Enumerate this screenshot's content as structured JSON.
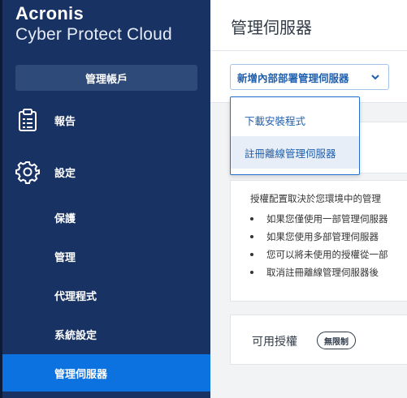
{
  "brand": {
    "name": "Acronis",
    "product": "Cyber Protect Cloud"
  },
  "sidebar": {
    "manage_account": "管理帳戶",
    "main_items": [
      {
        "label": "報告",
        "icon": "report-clipboard-icon"
      },
      {
        "label": "設定",
        "icon": "gear-icon"
      }
    ],
    "sub_items": [
      {
        "label": "保護"
      },
      {
        "label": "管理"
      },
      {
        "label": "代理程式"
      },
      {
        "label": "系統設定"
      },
      {
        "label": "管理伺服器",
        "active": true
      }
    ]
  },
  "main": {
    "title": "管理伺服器",
    "add_button": "新增內部部署管理伺服器",
    "dropdown": [
      {
        "label": "下載安裝程式"
      },
      {
        "label": "註冊離線管理伺服器",
        "hovered": true
      }
    ],
    "info_text": "授權配置取決於您環境中的管理",
    "bullets": [
      "如果您僅使用一部管理伺服器",
      "如果您使用多部管理伺服器",
      "您可以將未使用的授權從一部",
      "取消註冊離線管理伺服器後"
    ],
    "available_licenses": "可用授權",
    "unlimited_badge": "無限制"
  },
  "colors": {
    "sidebar_bg": "#183264",
    "active_item": "#0b72e0",
    "link_blue": "#1f5fad"
  }
}
